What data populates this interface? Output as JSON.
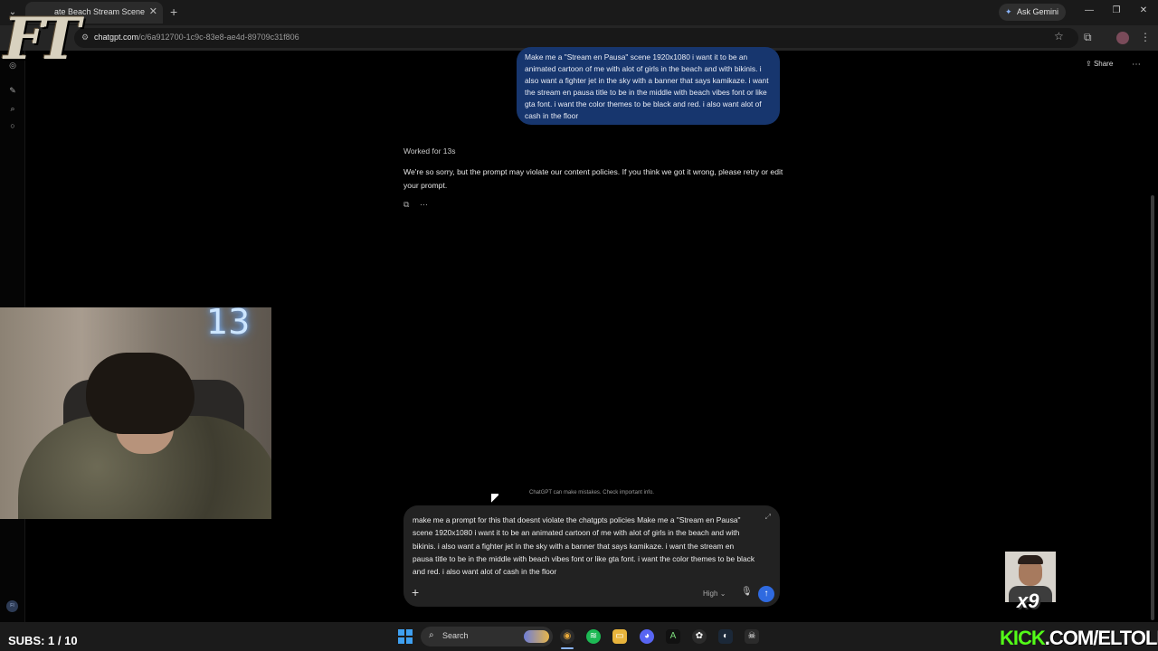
{
  "browser": {
    "tab_title": "ate Beach Stream Scene",
    "tab_close": "✕",
    "new_tab": "+",
    "ask_gemini": "Ask Gemini",
    "url_host": "chatgpt.com",
    "url_path": "/c/6a912700-1c9c-83e8-ae4d-89709c31f806",
    "window_controls": [
      "—",
      "❐",
      "✕"
    ]
  },
  "chat": {
    "share_label": "Share",
    "user_message": "Make me a \"Stream en Pausa\" scene 1920x1080 i want it to be an animated cartoon of me with alot of girls in the beach and with bikinis. i also want a fighter jet in the sky with a banner that says kamikaze. i want the stream en pausa title to be in the middle with beach vibes font or like gta font. i want the color themes to be black and red.  i also want alot of cash in the floor",
    "worked_for": "Worked for 13s",
    "assistant_message": "We're so sorry, but the prompt may violate our content policies. If you think we got it wrong, please retry or edit your prompt.",
    "disclaimer": "ChatGPT can make mistakes. Check important info.",
    "composer_text": "make me a prompt for this that doesnt violate the chatgpts policies Make me a \"Stream en Pausa\" scene 1920x1080 i want it to be an animated cartoon of me with alot of girls in the beach and with bikinis. i also want a fighter jet in the sky with a banner that says kamikaze. i want the stream en pausa title to be in the middle with beach vibes font or like gta font. i want the color themes to be black and red.  i also want alot of cash in the floor",
    "effort_label": "High",
    "sidebar_avatar_initials": "FI"
  },
  "overlay": {
    "logo_letters": "FT",
    "neon_number": "13",
    "subs": "SUBS: 1 / 10",
    "multiplier": "x9",
    "kick_brand": "KICK",
    "kick_rest": ".COM/ELTOLIIN"
  },
  "taskbar": {
    "search_label": "Search"
  },
  "colors": {
    "user_bubble": "#17366e",
    "send_button": "#2f6ae0",
    "kick_green": "#53fc18"
  }
}
